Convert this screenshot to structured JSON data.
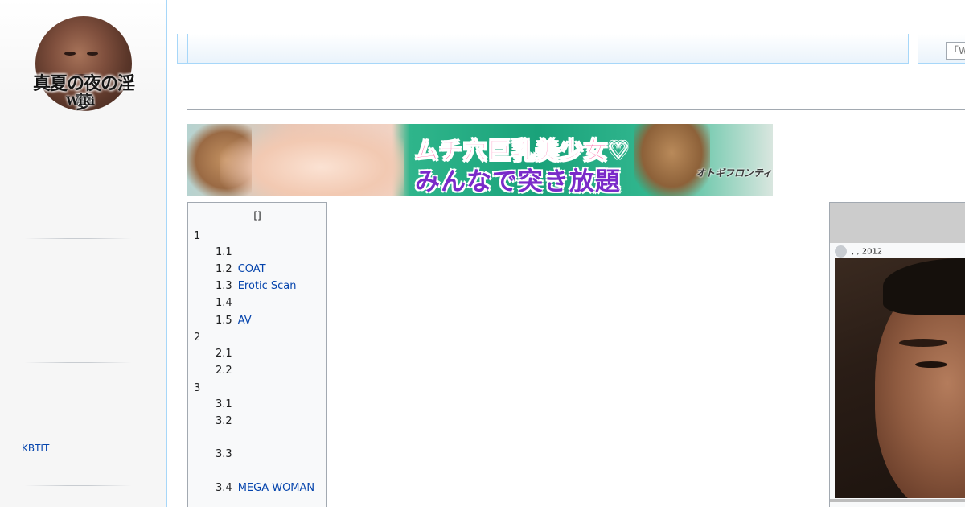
{
  "logo": {
    "title": "真夏の夜の淫夢",
    "subtitle": "Wiki",
    "icon": "wiki-logo-photo"
  },
  "sidebar": {
    "links": [
      {
        "label": "KBTIT"
      }
    ]
  },
  "search": {
    "placeholder": "「Wiki"
  },
  "banner": {
    "line1": "ムチ穴巨乳美少女♡",
    "line2": "みんなで突き放題",
    "logo_text": "オトギフロンティア"
  },
  "toc": {
    "title": "[]",
    "entries": [
      {
        "number": "1",
        "text": ""
      },
      {
        "number": "1.1",
        "text": ""
      },
      {
        "number": "1.2",
        "text": "COAT"
      },
      {
        "number": "1.3",
        "text": "Erotic Scan"
      },
      {
        "number": "1.4",
        "text": ""
      },
      {
        "number": "1.5",
        "text": "AV"
      },
      {
        "number": "2",
        "text": ""
      },
      {
        "number": "2.1",
        "text": ""
      },
      {
        "number": "2.2",
        "text": ""
      },
      {
        "number": "3",
        "text": ""
      },
      {
        "number": "3.1",
        "text": ""
      },
      {
        "number": "3.2",
        "text": ""
      },
      {
        "number": "3.3",
        "text": ""
      },
      {
        "number": "3.4",
        "text": "MEGA WOMAN"
      }
    ]
  },
  "infobox": {
    "meta": ", , 2012"
  }
}
